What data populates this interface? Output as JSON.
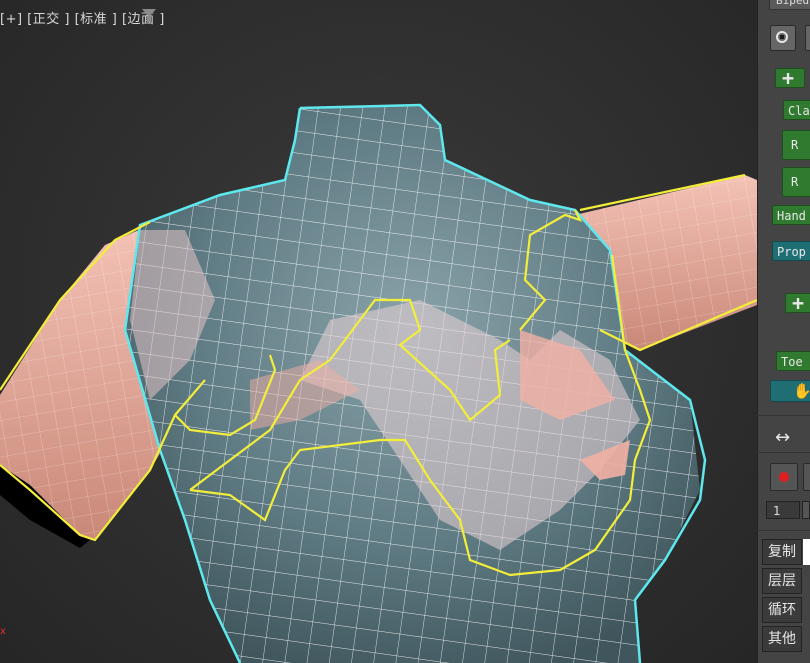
{
  "viewport": {
    "label": "[+] [正交 ] [标准 ] [边面 ]",
    "axis_label": "x"
  },
  "panel": {
    "title": "Biped",
    "buttons": {
      "clavicle": "Cla",
      "r1": "R",
      "r2": "R",
      "hand": "Hand",
      "prop": "Prop",
      "toe": "Toe",
      "frame_value": "1"
    },
    "actions": [
      "复制",
      "层层",
      "循环",
      "其他"
    ]
  },
  "colors": {
    "mesh_fill": "#5e7a82",
    "skin": "#e8a89c",
    "wire": "#ffffff",
    "selection_outline": "#5ee8ee",
    "yellow_outline": "#f2ee3a",
    "green_button": "#2f7a2f",
    "teal_button": "#1f6e74"
  }
}
